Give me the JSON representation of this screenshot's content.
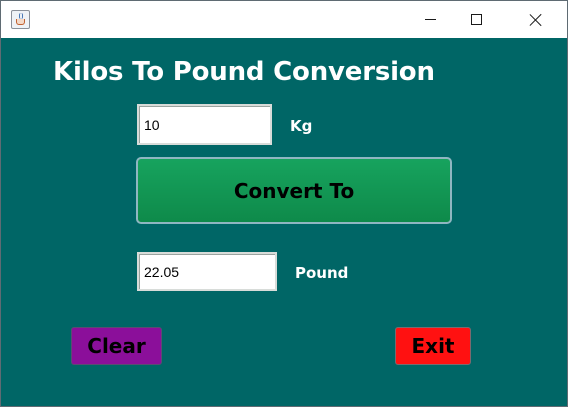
{
  "window": {
    "title": "",
    "icon": "java-app-icon",
    "controls": {
      "minimize": "minimize-icon",
      "maximize": "maximize-icon",
      "close": "close-icon"
    }
  },
  "app": {
    "heading": "Kilos To Pound Conversion",
    "kg_input": {
      "value": "10",
      "unit_label": "Kg"
    },
    "convert_button": "Convert To",
    "pound_output": {
      "value": "22.05",
      "unit_label": "Pound"
    },
    "clear_button": "Clear",
    "exit_button": "Exit"
  },
  "colors": {
    "panel_background": "#006666",
    "convert_button": "#10944f",
    "clear_button": "#8b0f9a",
    "exit_button": "#ff1111"
  }
}
